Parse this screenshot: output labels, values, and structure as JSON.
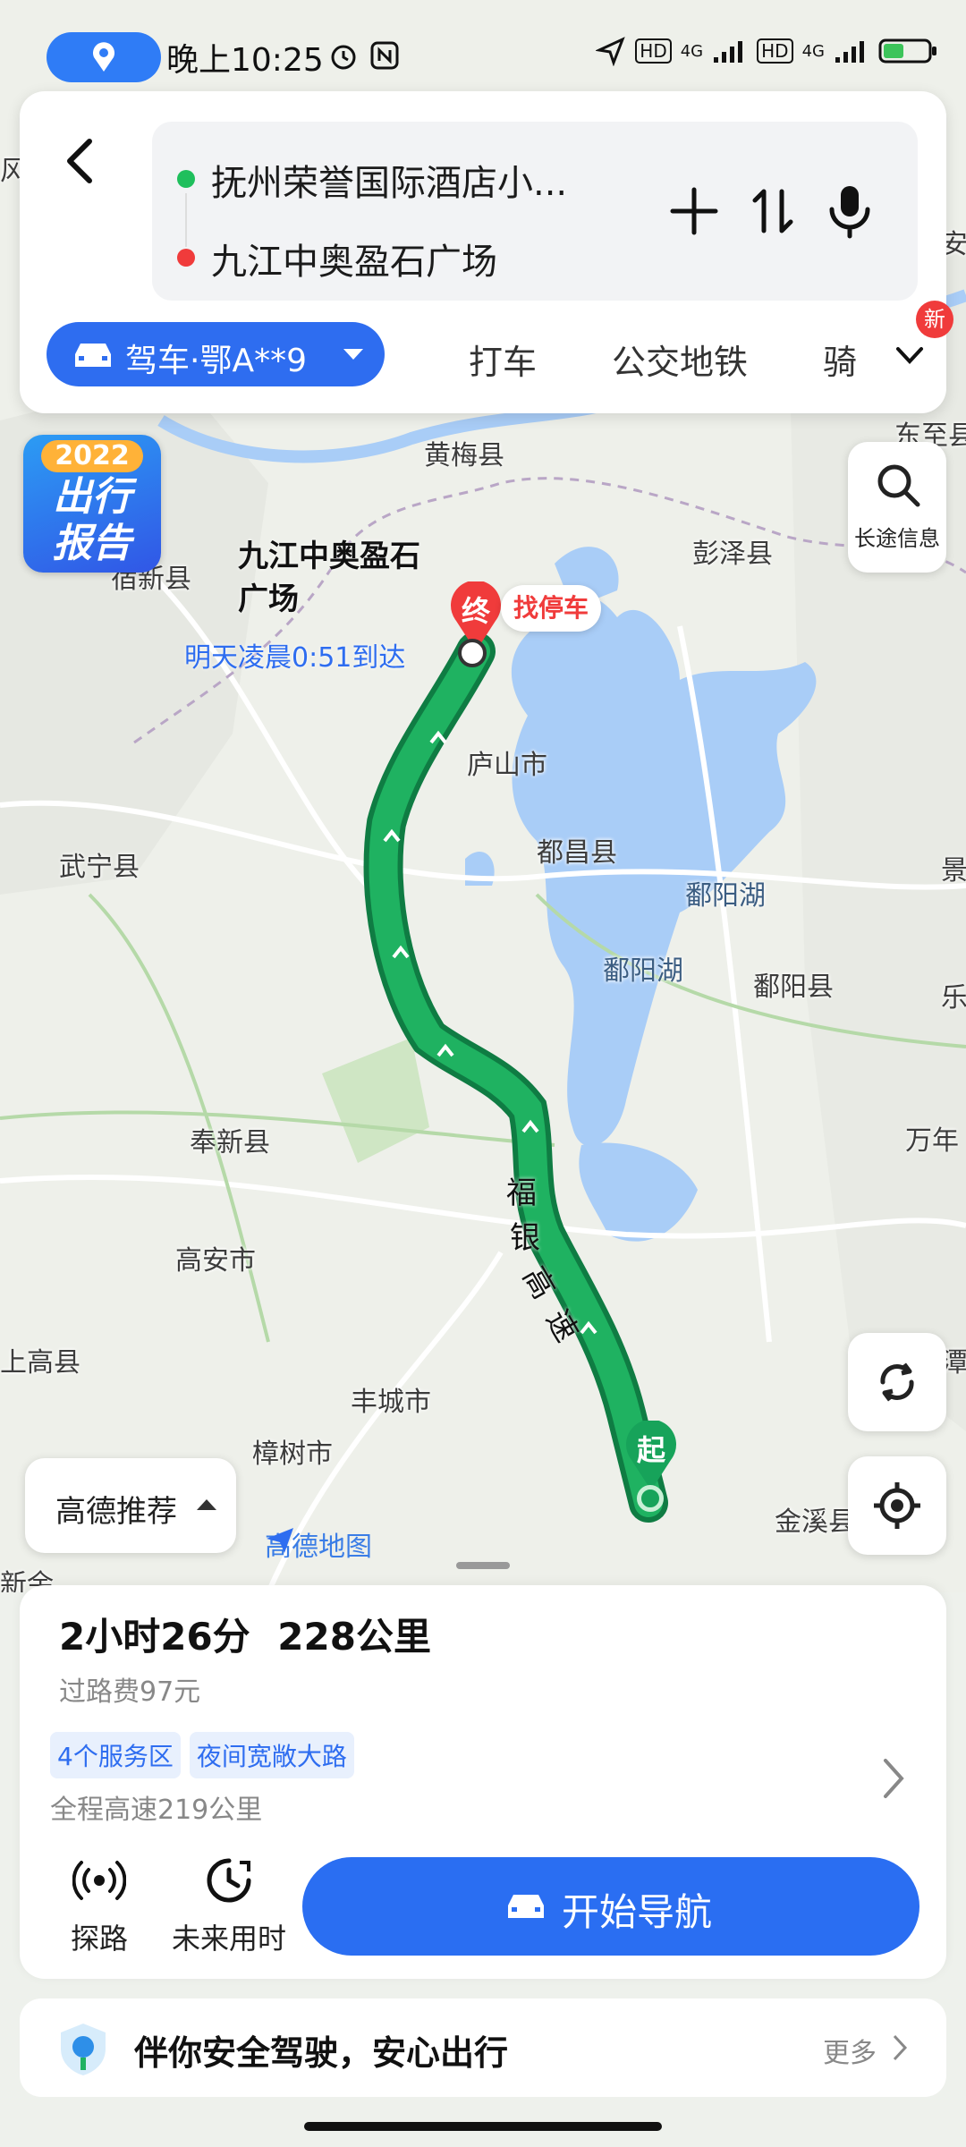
{
  "status_bar": {
    "time": "晚上10:25",
    "network_1": "4G",
    "network_2": "4G",
    "hd_1": "HD",
    "hd_2": "HD"
  },
  "search": {
    "origin": "抚州荣誉国际酒店小...",
    "destination": "九江中奥盈石广场",
    "origin_color": "#1fbf5c",
    "destination_color": "#f03b3b"
  },
  "modes": {
    "drive_label": "驾车·鄂A**9",
    "taxi": "打车",
    "transit": "公交地铁",
    "bike": "骑",
    "new_badge": "新"
  },
  "map": {
    "promo_year": "2022",
    "promo_line1": "出行",
    "promo_line2": "报告",
    "long_trip": "长途信息",
    "dest_name_line1": "九江中奥盈石",
    "dest_name_line2": "广场",
    "end_marker": "终",
    "parking": "找停车",
    "arrival": "明天凌晨0:51到达",
    "start_marker": "起",
    "highway": [
      "福",
      "银",
      "高",
      "速"
    ],
    "recommend": "高德推荐",
    "brand": "高德地图",
    "labels": {
      "huangmei": "黄梅县",
      "pengze": "彭泽县",
      "dongzhi": "东至县",
      "suxian": "宿新县",
      "lushan": "庐山市",
      "duchang": "都昌县",
      "poyang_lake_1": "鄱阳湖",
      "poyang_lake_2": "鄱阳湖",
      "poyang_county": "鄱阳县",
      "wuning": "武宁县",
      "fengxin": "奉新县",
      "gaoan": "高安市",
      "fengcheng": "丰城市",
      "zhangshu": "樟树市",
      "shanggao": "上高县",
      "jinxi": "金溪县",
      "wannian": "万年",
      "xinyu": "新余",
      "left_feng": "风",
      "right_an": "安",
      "right_jing": "景",
      "right_le": "乐",
      "right_tan": "潭"
    }
  },
  "route": {
    "duration": "2小时26分",
    "distance": "228公里",
    "toll": "过路费97元",
    "tags": [
      "4个服务区",
      "夜间宽敞大路"
    ],
    "highway_note": "全程高速219公里",
    "explore": "探路",
    "future": "未来用时",
    "start_nav": "开始导航"
  },
  "safety": {
    "text": "伴你安全驾驶，安心出行",
    "more": "更多"
  },
  "colors": {
    "accent": "#2e6df0",
    "route_green": "#19a35a",
    "route_dark": "#0f7c43",
    "water": "#a9cdf7"
  }
}
